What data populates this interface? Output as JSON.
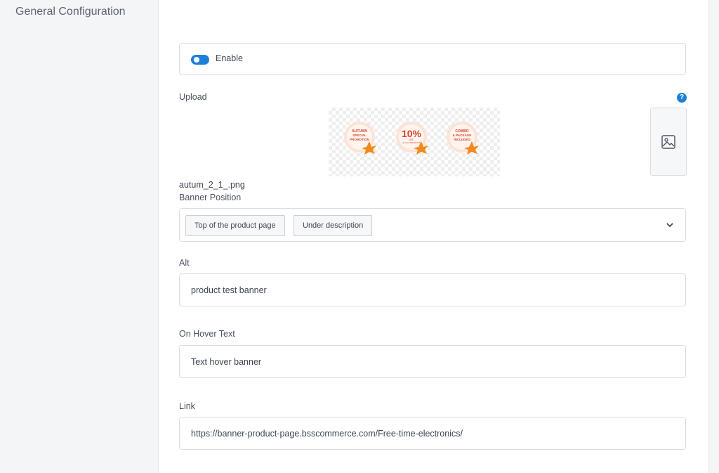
{
  "sidebar": {
    "title": "General Configuration"
  },
  "enable": {
    "label": "Enable",
    "checked": true
  },
  "upload": {
    "label": "Upload",
    "help": "?",
    "filename": "autum_2_1_.png",
    "banner_badges": [
      {
        "line1": "AUTUMN",
        "line2": "SPECIAL",
        "line3": "PROMOTION"
      },
      {
        "line1": "10%",
        "line2": "OFF",
        "line3": "ALL EXTENSIONS"
      },
      {
        "line1": "COMBO",
        "line2": "& PACKAGE",
        "line3": "INCLUDED"
      }
    ]
  },
  "banner_position": {
    "label": "Banner Position",
    "selected": [
      "Top of the product page",
      "Under description"
    ]
  },
  "alt": {
    "label": "Alt",
    "value": "product test banner"
  },
  "hover": {
    "label": "On Hover Text",
    "value": "Text hover banner"
  },
  "link": {
    "label": "Link",
    "value": "https://banner-product-page.bsscommerce.com/Free-time-electronics/"
  },
  "colors": {
    "accent": "#1e7fd8",
    "border": "#d8dde3",
    "leaf": "#f08a1c",
    "badge_text": "#d9442a"
  }
}
